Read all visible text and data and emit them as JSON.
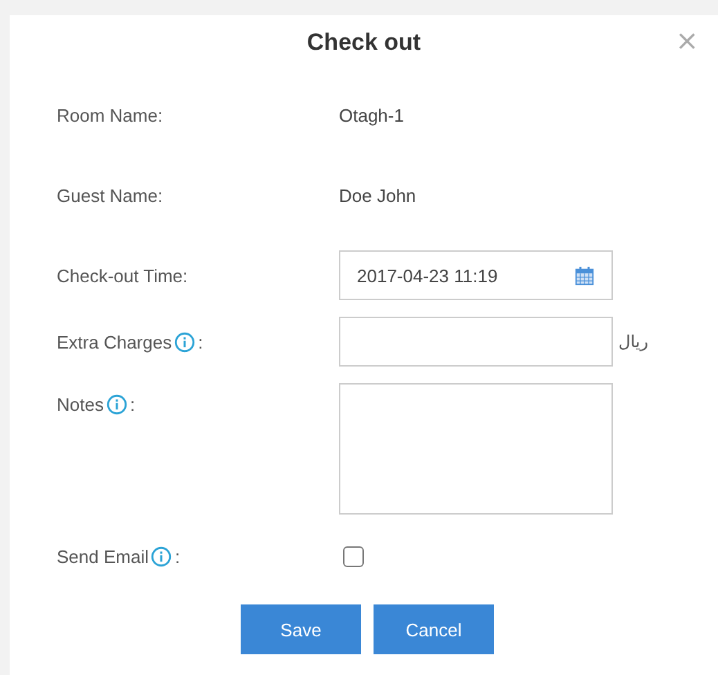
{
  "dialog": {
    "title": "Check out",
    "close": "×"
  },
  "fields": [
    {
      "kind": "text",
      "label": "Room Name:",
      "value": "Otagh-1"
    },
    {
      "kind": "text",
      "label": "Guest Name:",
      "value": "Doe John"
    },
    {
      "kind": "date",
      "label": "Check-out Time:",
      "value": "2017-04-23 11:19"
    },
    {
      "kind": "input",
      "label": "Extra Charges",
      "info": true,
      "label_end": ":",
      "suffix": "ریال"
    },
    {
      "kind": "textarea",
      "label": "Notes",
      "info": true,
      "label_end": ":"
    },
    {
      "kind": "checkbox",
      "label": "Send Email",
      "info": true,
      "label_end": ":",
      "checked": false
    }
  ],
  "buttons": [
    "Save",
    "Cancel"
  ]
}
